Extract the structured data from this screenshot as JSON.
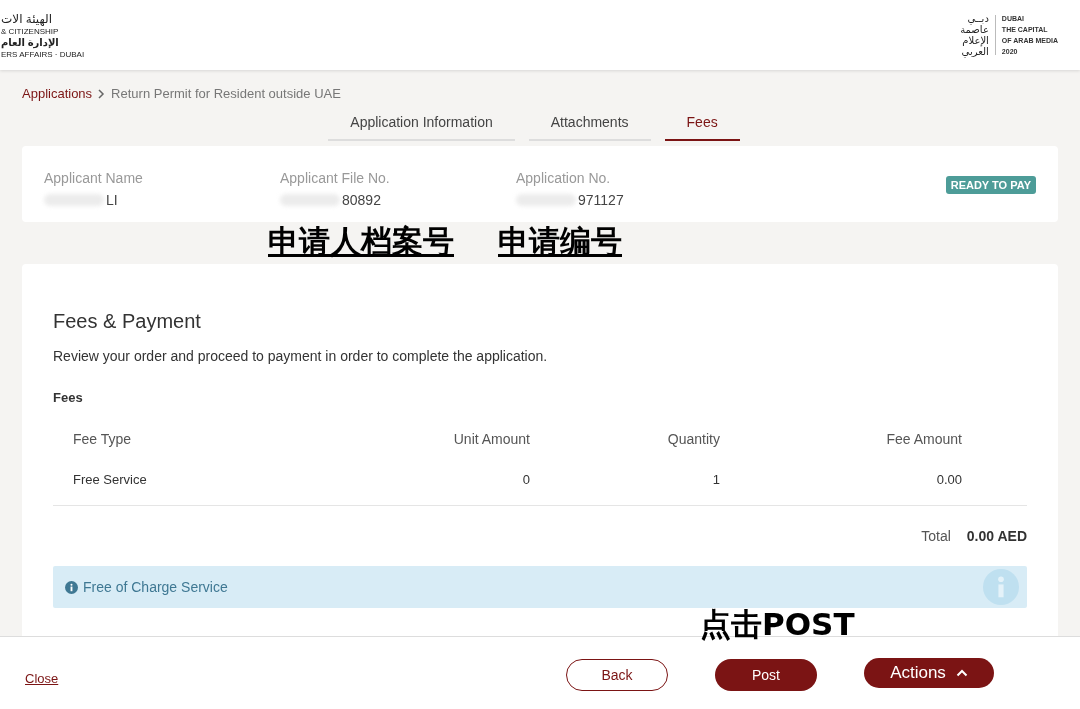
{
  "header": {
    "left_logo": {
      "lines": [
        "الهيئة الات",
        "& CITIZENSHIP",
        "الإدارة العام",
        "ERS AFFAIRS · DUBAI"
      ]
    },
    "right_logo": {
      "arabic_lines": [
        "دبــي",
        "عاصمة",
        "الإعلام",
        "العربي"
      ],
      "lines": [
        "DUBAI",
        "THE CAPITAL",
        "OF ARAB MEDIA",
        "2020"
      ]
    }
  },
  "breadcrumb": {
    "link": "Applications",
    "current": "Return Permit for Resident outside UAE"
  },
  "tabs": [
    {
      "label": "Application Information",
      "selected": false
    },
    {
      "label": "Attachments",
      "selected": false
    },
    {
      "label": "Fees",
      "selected": true
    }
  ],
  "summary": {
    "fields": [
      {
        "label": "Applicant Name",
        "value": "LI"
      },
      {
        "label": "Applicant File No.",
        "value": "80892"
      },
      {
        "label": "Application No.",
        "value": "971127"
      }
    ],
    "status": "READY TO PAY"
  },
  "annotations": [
    {
      "text": "申请人档案号"
    },
    {
      "text": "申请编号"
    },
    {
      "text": "点击POST"
    }
  ],
  "fees": {
    "title": "Fees & Payment",
    "description": "Review your order and proceed to payment in order to complete the application.",
    "section": "Fees",
    "columns": [
      "Fee Type",
      "Unit Amount",
      "Quantity",
      "Fee Amount"
    ],
    "rows": [
      [
        "Free Service",
        "0",
        "1",
        "0.00"
      ]
    ],
    "total_label": "Total",
    "total_value": "0.00 AED",
    "notice": "Free of Charge Service"
  },
  "footer": {
    "close": "Close",
    "buttons": [
      {
        "label": "Back",
        "kind": "outline"
      },
      {
        "label": "Post",
        "kind": "filled"
      }
    ],
    "actions": "Actions"
  }
}
